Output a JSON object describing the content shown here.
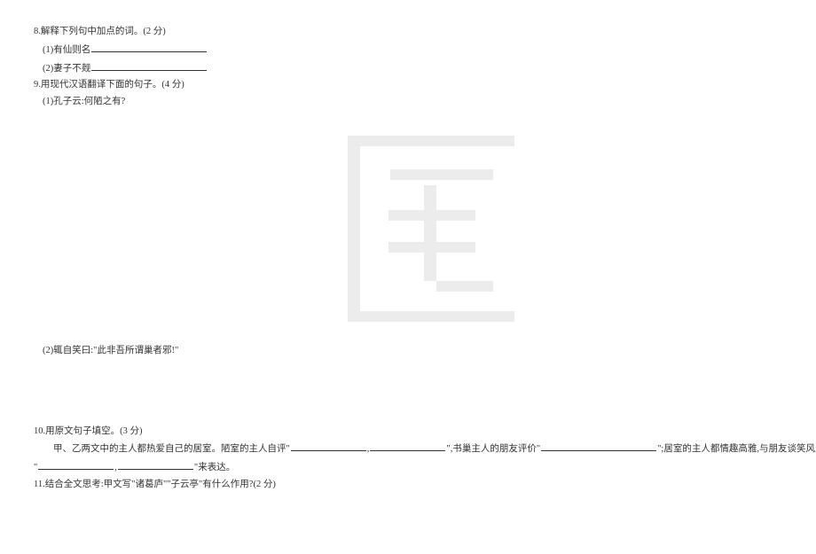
{
  "q8": {
    "prompt": "8.解释下列句中加点的词。(2 分)",
    "item1_prefix": "(1)有仙则名",
    "item2_prefix": "(2)妻子不觌"
  },
  "q9": {
    "prompt": "9.用现代汉语翻译下面的句子。(4 分)",
    "item1": "(1)孔子云:何陋之有?",
    "item2": "(2)辄自笑曰:\"此非吾所谓巢者邪!\""
  },
  "q10": {
    "prefix": "10.用原文句子填空。(3 分)",
    "body_part1": "甲、乙两文中的主人都热爱自己的居室。陋室的主人自评\"",
    "body_comma": ",",
    "body_part2": "\",书巢主人的朋友评价\"",
    "body_part3": "\";居室的主人都情趣高雅,与朋友谈笑风生,这个意思可以用甲文中的",
    "line2_open": "\"",
    "line2_comma": ",",
    "line2_close": "\"来表达。"
  },
  "q11": {
    "prompt": "11.结合全文思考:甲文写\"诸葛庐\"\"子云亭\"有什么作用?(2 分)"
  }
}
